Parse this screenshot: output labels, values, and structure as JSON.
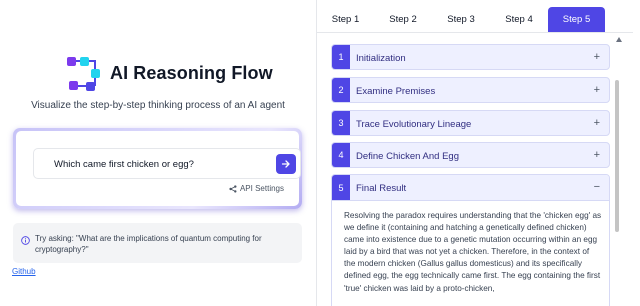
{
  "app": {
    "title": "AI Reasoning Flow",
    "subtitle": "Visualize the step-by-step thinking process of an AI agent"
  },
  "query": {
    "value": "Which came first chicken or egg?",
    "api_settings_label": "API Settings"
  },
  "hint": {
    "text": "Try asking: \"What are the implications of quantum computing for cryptography?\""
  },
  "footer": {
    "github_label": "Github"
  },
  "tabs": [
    "Step 1",
    "Step 2",
    "Step 3",
    "Step 4",
    "Step 5"
  ],
  "active_tab": "Step 5",
  "steps": [
    {
      "num": "1",
      "title": "Initialization",
      "toggle": "+"
    },
    {
      "num": "2",
      "title": "Examine Premises",
      "toggle": "+"
    },
    {
      "num": "3",
      "title": "Trace Evolutionary Lineage",
      "toggle": "+"
    },
    {
      "num": "4",
      "title": "Define Chicken And Egg",
      "toggle": "+"
    },
    {
      "num": "5",
      "title": "Final Result",
      "toggle": "−"
    }
  ],
  "final_result": "Resolving the paradox requires understanding that the 'chicken egg' as we define it (containing and hatching a genetically defined chicken) came into existence due to a genetic mutation occurring within an egg laid by a bird that was not yet a chicken. Therefore, in the context of the modern chicken (Gallus gallus domesticus) and its specifically defined egg, the egg technically came first. The egg containing the first 'true' chicken was laid by a proto-chicken,",
  "colors": {
    "accent": "#4f46e5",
    "step_bg": "#eef0ff",
    "link": "#2563eb"
  }
}
